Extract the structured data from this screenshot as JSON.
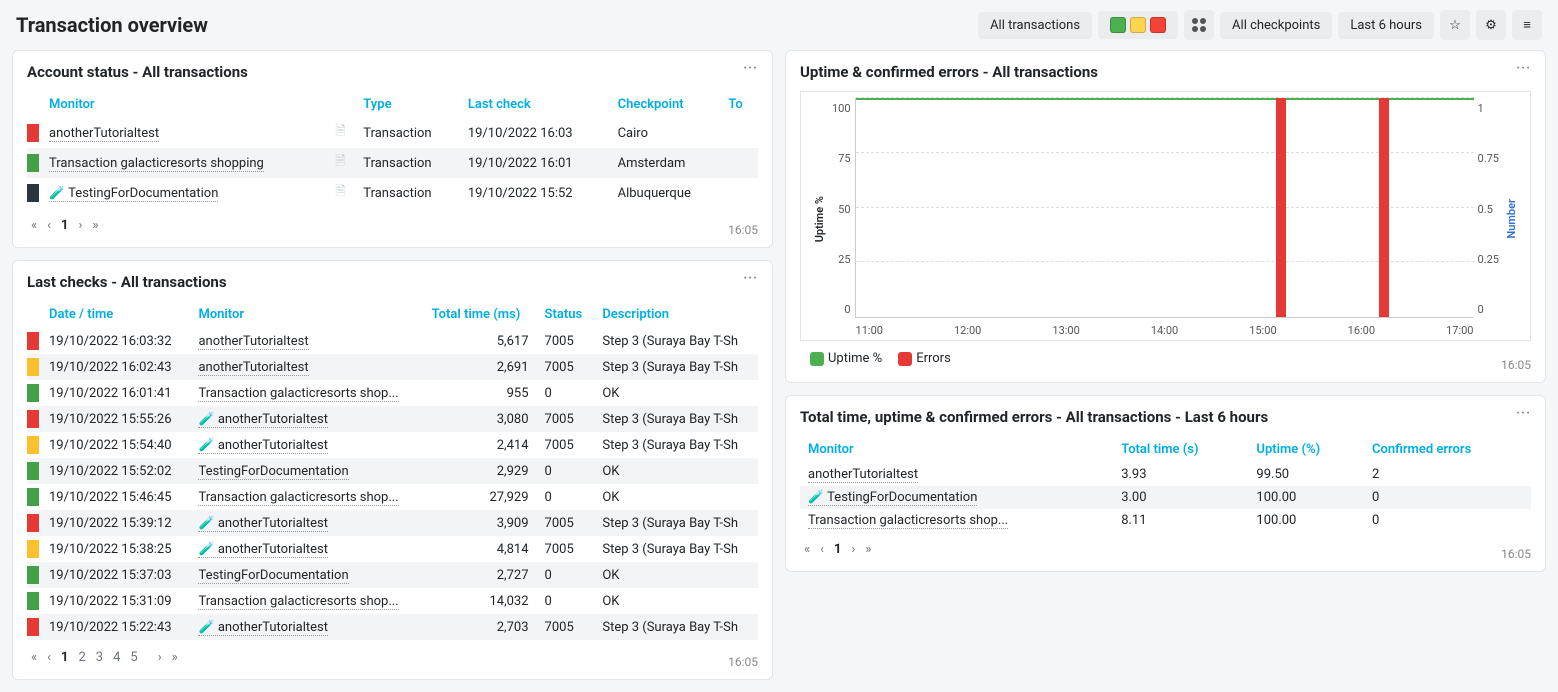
{
  "page_title": "Transaction overview",
  "toolbar": {
    "filter_label": "All transactions",
    "checkpoints_label": "All checkpoints",
    "range_label": "Last 6 hours",
    "status_colors": [
      "#4caf50",
      "#ffd54f",
      "#f44336"
    ]
  },
  "timestamp": "16:05",
  "panel1": {
    "title": "Account status - All transactions",
    "columns": {
      "monitor": "Monitor",
      "type": "Type",
      "last": "Last check",
      "checkpoint": "Checkpoint",
      "total": "To"
    },
    "rows": [
      {
        "status": "red",
        "monitor": "anotherTutorialtest",
        "type": "Transaction",
        "last": "19/10/2022 16:03",
        "checkpoint": "Cairo"
      },
      {
        "status": "green",
        "monitor": "Transaction galacticresorts shopping",
        "type": "Transaction",
        "last": "19/10/2022 16:01",
        "checkpoint": "Amsterdam"
      },
      {
        "status": "dark",
        "monitor": "TestingForDocumentation",
        "type": "Transaction",
        "last": "19/10/2022 15:52",
        "checkpoint": "Albuquerque",
        "staged": true
      }
    ],
    "pagination": [
      "1"
    ]
  },
  "panel2": {
    "title": "Last checks - All transactions",
    "columns": {
      "dt": "Date / time",
      "monitor": "Monitor",
      "total": "Total time (ms)",
      "status": "Status",
      "desc": "Description"
    },
    "rows": [
      {
        "status": "red",
        "dt": "19/10/2022 16:03:32",
        "monitor": "anotherTutorialtest",
        "total": "5,617",
        "code": "7005",
        "desc": "Step 3 (Suraya Bay T-Sh"
      },
      {
        "status": "yellow",
        "dt": "19/10/2022 16:02:43",
        "monitor": "anotherTutorialtest",
        "total": "2,691",
        "code": "7005",
        "desc": "Step 3 (Suraya Bay T-Sh"
      },
      {
        "status": "green",
        "dt": "19/10/2022 16:01:41",
        "monitor": "Transaction galacticresorts shop...",
        "total": "955",
        "code": "0",
        "desc": "OK"
      },
      {
        "status": "red",
        "dt": "19/10/2022 15:55:26",
        "monitor": "anotherTutorialtest",
        "staged": true,
        "total": "3,080",
        "code": "7005",
        "desc": "Step 3 (Suraya Bay T-Sh"
      },
      {
        "status": "yellow",
        "dt": "19/10/2022 15:54:40",
        "monitor": "anotherTutorialtest",
        "staged": true,
        "total": "2,414",
        "code": "7005",
        "desc": "Step 3 (Suraya Bay T-Sh"
      },
      {
        "status": "green",
        "dt": "19/10/2022 15:52:02",
        "monitor": "TestingForDocumentation",
        "total": "2,929",
        "code": "0",
        "desc": "OK"
      },
      {
        "status": "green",
        "dt": "19/10/2022 15:46:45",
        "monitor": "Transaction galacticresorts shop...",
        "total": "27,929",
        "code": "0",
        "desc": "OK"
      },
      {
        "status": "red",
        "dt": "19/10/2022 15:39:12",
        "monitor": "anotherTutorialtest",
        "staged": true,
        "total": "3,909",
        "code": "7005",
        "desc": "Step 3 (Suraya Bay T-Sh"
      },
      {
        "status": "yellow",
        "dt": "19/10/2022 15:38:25",
        "monitor": "anotherTutorialtest",
        "staged": true,
        "total": "4,814",
        "code": "7005",
        "desc": "Step 3 (Suraya Bay T-Sh"
      },
      {
        "status": "green",
        "dt": "19/10/2022 15:37:03",
        "monitor": "TestingForDocumentation",
        "total": "2,727",
        "code": "0",
        "desc": "OK"
      },
      {
        "status": "green",
        "dt": "19/10/2022 15:31:09",
        "monitor": "Transaction galacticresorts shop...",
        "total": "14,032",
        "code": "0",
        "desc": "OK"
      },
      {
        "status": "red",
        "dt": "19/10/2022 15:22:43",
        "monitor": "anotherTutorialtest",
        "staged": true,
        "total": "2,703",
        "code": "7005",
        "desc": "Step 3 (Suraya Bay T-Sh"
      }
    ],
    "pagination": [
      "1",
      "2",
      "3",
      "4",
      "5"
    ]
  },
  "panel3": {
    "title": "Uptime & confirmed errors - All transactions",
    "legend": {
      "uptime": "Uptime %",
      "errors": "Errors"
    },
    "ylabel_left": "Uptime %",
    "ylabel_right": "Number"
  },
  "chart_data": {
    "type": "line_bar_combo",
    "x_ticks": [
      "11:00",
      "12:00",
      "13:00",
      "14:00",
      "15:00",
      "16:00",
      "17:00"
    ],
    "y_left": {
      "label": "Uptime %",
      "ticks": [
        0,
        25,
        50,
        75,
        100
      ],
      "range": [
        0,
        100
      ]
    },
    "y_right": {
      "label": "Number",
      "ticks": [
        0,
        0.25,
        0.5,
        0.75,
        1
      ],
      "range": [
        0,
        1
      ]
    },
    "series": [
      {
        "name": "Uptime %",
        "axis": "left",
        "type": "line",
        "color": "#4caf50",
        "points": [
          {
            "x": "11:00",
            "y": 100
          },
          {
            "x": "12:00",
            "y": 100
          },
          {
            "x": "13:00",
            "y": 100
          },
          {
            "x": "14:00",
            "y": 100
          },
          {
            "x": "15:00",
            "y": 100
          },
          {
            "x": "15:05",
            "y": 97
          },
          {
            "x": "15:30",
            "y": 100
          },
          {
            "x": "16:00",
            "y": 100
          },
          {
            "x": "16:05",
            "y": 97
          }
        ]
      },
      {
        "name": "Errors",
        "axis": "right",
        "type": "bar",
        "color": "#e53935",
        "points": [
          {
            "x": "15:05",
            "y": 1
          },
          {
            "x": "16:05",
            "y": 1
          }
        ]
      }
    ]
  },
  "panel4": {
    "title": "Total time, uptime & confirmed errors - All transactions - Last 6 hours",
    "columns": {
      "monitor": "Monitor",
      "total": "Total time (s)",
      "uptime": "Uptime (%)",
      "errors": "Confirmed errors"
    },
    "rows": [
      {
        "monitor": "anotherTutorialtest",
        "total": "3.93",
        "uptime": "99.50",
        "errors": "2"
      },
      {
        "monitor": "TestingForDocumentation",
        "staged": true,
        "total": "3.00",
        "uptime": "100.00",
        "errors": "0"
      },
      {
        "monitor": "Transaction galacticresorts shop...",
        "total": "8.11",
        "uptime": "100.00",
        "errors": "0"
      }
    ],
    "pagination": [
      "1"
    ]
  }
}
